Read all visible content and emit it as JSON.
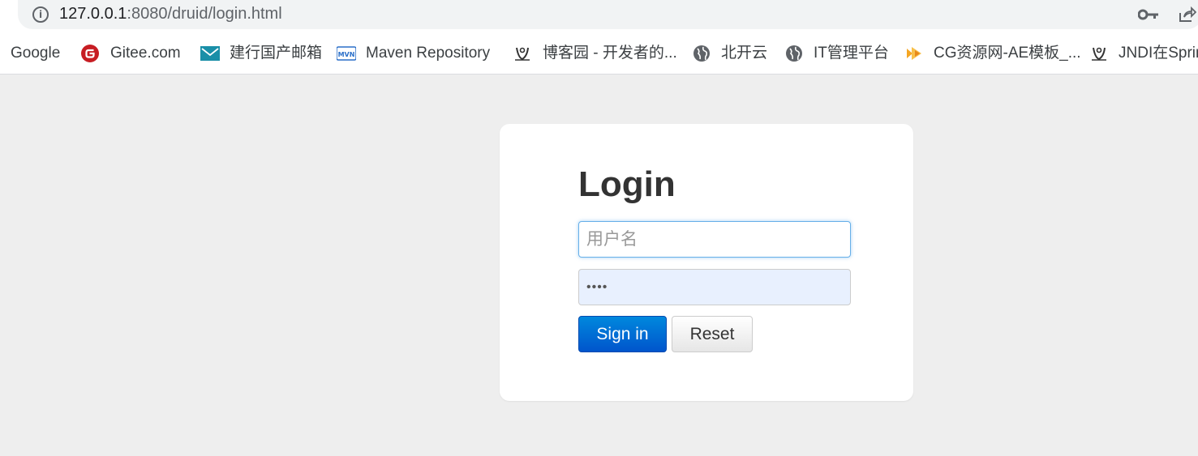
{
  "browser": {
    "url_host": "127.0.0.1",
    "url_rest": ":8080/druid/login.html",
    "icons": {
      "info": "info-icon",
      "key": "key-icon",
      "share": "share-icon"
    }
  },
  "bookmarks": [
    {
      "label": "Google",
      "icon": "none"
    },
    {
      "label": "Gitee.com",
      "icon": "gitee-icon",
      "color": "#c71d23"
    },
    {
      "label": "建行国产邮箱",
      "icon": "mail-icon",
      "color": "#1a8fa8"
    },
    {
      "label": "Maven Repository",
      "icon": "mvn-icon",
      "color": "#2a6fc9"
    },
    {
      "label": "博客园 - 开发者的...",
      "icon": "cnblogs-icon",
      "color": "#333333"
    },
    {
      "label": "北开云",
      "icon": "globe-icon",
      "color": "#5f6368"
    },
    {
      "label": "IT管理平台",
      "icon": "globe-icon",
      "color": "#5f6368"
    },
    {
      "label": "CG资源网-AE模板_...",
      "icon": "cg-icon",
      "color": "#f5a623"
    },
    {
      "label": "JNDI在Spring",
      "icon": "cnblogs-icon",
      "color": "#333333"
    }
  ],
  "login": {
    "title": "Login",
    "username_placeholder": "用户名",
    "username_value": "",
    "password_value": "••••",
    "signin_label": "Sign in",
    "reset_label": "Reset",
    "primary_color": "#0066cc"
  }
}
